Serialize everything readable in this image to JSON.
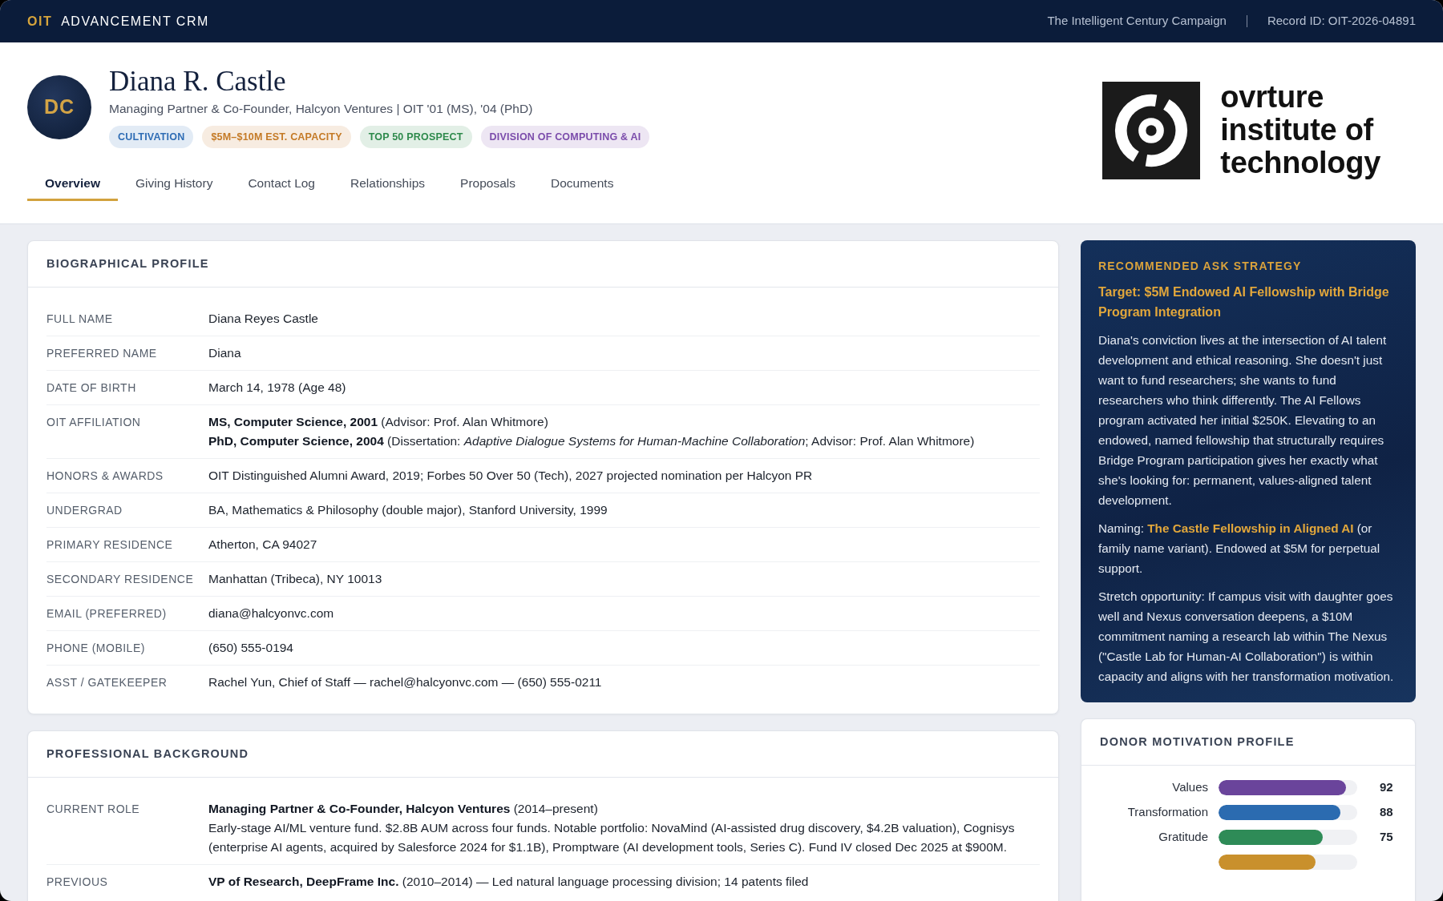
{
  "top_bar": {
    "brand_mark": "OIT",
    "brand_name": "ADVANCEMENT CRM",
    "campaign": "The Intelligent Century Campaign",
    "record_id": "Record ID: OIT-2026-04891"
  },
  "profile": {
    "initials": "DC",
    "name": "Diana R. Castle",
    "subtitle": "Managing Partner & Co-Founder, Halcyon Ventures | OIT '01 (MS), '04 (PhD)",
    "tags": [
      {
        "label": "CULTIVATION",
        "color": "#2f6db5"
      },
      {
        "label": "$5M–$10M EST. CAPACITY",
        "color": "#c47a26"
      },
      {
        "label": "TOP 50 PROSPECT",
        "color": "#2e8a4c"
      },
      {
        "label": "DIVISION OF COMPUTING & AI",
        "color": "#7b4cab"
      }
    ]
  },
  "logo": {
    "wordmark": [
      "ovrture",
      "institute of",
      "technology"
    ]
  },
  "tabs": [
    {
      "label": "Overview",
      "selected": true
    },
    {
      "label": "Giving History",
      "selected": false
    },
    {
      "label": "Contact Log",
      "selected": false
    },
    {
      "label": "Relationships",
      "selected": false
    },
    {
      "label": "Proposals",
      "selected": false
    },
    {
      "label": "Documents",
      "selected": false
    }
  ],
  "sections": [
    {
      "title": "BIOGRAPHICAL PROFILE",
      "rows": [
        {
          "label": "FULL NAME",
          "lines": [
            "Diana Reyes Castle"
          ]
        },
        {
          "label": "PREFERRED NAME",
          "lines": [
            "Diana"
          ]
        },
        {
          "label": "DATE OF BIRTH",
          "lines": [
            "March 14, 1978 (Age 48)"
          ]
        },
        {
          "label": "OIT AFFILIATION",
          "lines": [
            "**MS, Computer Science, 2001** (Advisor: Prof. Alan Whitmore)",
            "**PhD, Computer Science, 2004** (Dissertation: *Adaptive Dialogue Systems for Human-Machine Collaboration*; Advisor: Prof. Alan Whitmore)"
          ]
        },
        {
          "label": "HONORS & AWARDS",
          "lines": [
            "OIT Distinguished Alumni Award, 2019; Forbes 50 Over 50 (Tech), 2027 projected nomination per Halcyon PR"
          ]
        },
        {
          "label": "UNDERGRAD",
          "lines": [
            "BA, Mathematics & Philosophy (double major), Stanford University, 1999"
          ]
        },
        {
          "label": "PRIMARY RESIDENCE",
          "lines": [
            "Atherton, CA 94027"
          ]
        },
        {
          "label": "SECONDARY RESIDENCE",
          "lines": [
            "Manhattan (Tribeca), NY 10013"
          ]
        },
        {
          "label": "EMAIL (PREFERRED)",
          "lines": [
            "diana@halcyonvc.com"
          ]
        },
        {
          "label": "PHONE (MOBILE)",
          "lines": [
            "(650) 555-0194"
          ]
        },
        {
          "label": "ASST / GATEKEEPER",
          "lines": [
            "Rachel Yun, Chief of Staff — rachel@halcyonvc.com — (650) 555-0211"
          ]
        }
      ]
    },
    {
      "title": "PROFESSIONAL BACKGROUND",
      "rows": [
        {
          "label": "CURRENT ROLE",
          "lines": [
            "**Managing Partner & Co-Founder, Halcyon Ventures** (2014–present)",
            "Early-stage AI/ML venture fund. $2.8B AUM across four funds. Notable portfolio: NovaMind (AI-assisted drug discovery, $4.2B valuation), Cognisys (enterprise AI agents, acquired by Salesforce 2024 for $1.1B), Promptware (AI development tools, Series C). Fund IV closed Dec 2025 at $900M."
          ]
        },
        {
          "label": "PREVIOUS",
          "lines": [
            "**VP of Research, DeepFrame Inc.** (2010–2014) — Led natural language processing division; 14 patents filed"
          ]
        }
      ]
    }
  ],
  "strategy": {
    "title": "RECOMMENDED ASK STRATEGY",
    "target": "Target: $5M Endowed AI Fellowship with Bridge Program Integration",
    "paragraphs": [
      "Diana's conviction lives at the intersection of AI talent development and ethical reasoning. She doesn't just want to fund researchers; she wants to fund researchers who think differently. The AI Fellows program activated her initial $250K. Elevating to an endowed, named fellowship that structurally requires Bridge Program participation gives her exactly what she's looking for: permanent, values-aligned talent development.",
      "Naming: **The Castle Fellowship in Aligned AI** (or family name variant). Endowed at $5M for perpetual support.",
      "Stretch opportunity: If campus visit with daughter goes well and Nexus conversation deepens, a $10M commitment naming a research lab within The Nexus (\"Castle Lab for Human-AI Collaboration\") is within capacity and aligns with her transformation motivation."
    ]
  },
  "motivation": {
    "title": "DONOR MOTIVATION PROFILE",
    "rows": [
      {
        "label": "Values",
        "value": "92",
        "level": 0.92,
        "color": "#6a449b"
      },
      {
        "label": "Transformation",
        "value": "88",
        "level": 0.88,
        "color": "#2b6bb0"
      },
      {
        "label": "Gratitude",
        "value": "75",
        "level": 0.75,
        "color": "#2e8b57"
      },
      {
        "level": 0.7,
        "color": "#c9902c"
      }
    ]
  }
}
